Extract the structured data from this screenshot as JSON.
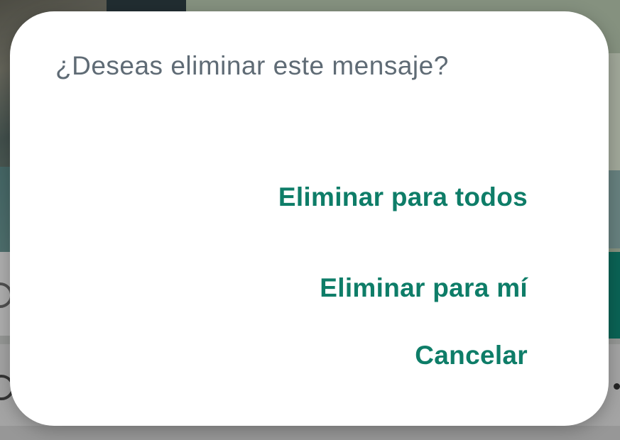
{
  "dialog": {
    "title": "¿Deseas eliminar este mensaje?",
    "actions": [
      {
        "label": "Eliminar para todos"
      },
      {
        "label": "Eliminar para mí"
      },
      {
        "label": "Cancelar"
      }
    ]
  },
  "colors": {
    "title_text": "#5f6b75",
    "action_text": "#0e7d68",
    "dialog_background": "#ffffff",
    "scrim": "rgba(0,0,0,0.28)"
  },
  "background_icons": [
    "emoji-icon",
    "emoji-icon",
    "mic-icon"
  ]
}
